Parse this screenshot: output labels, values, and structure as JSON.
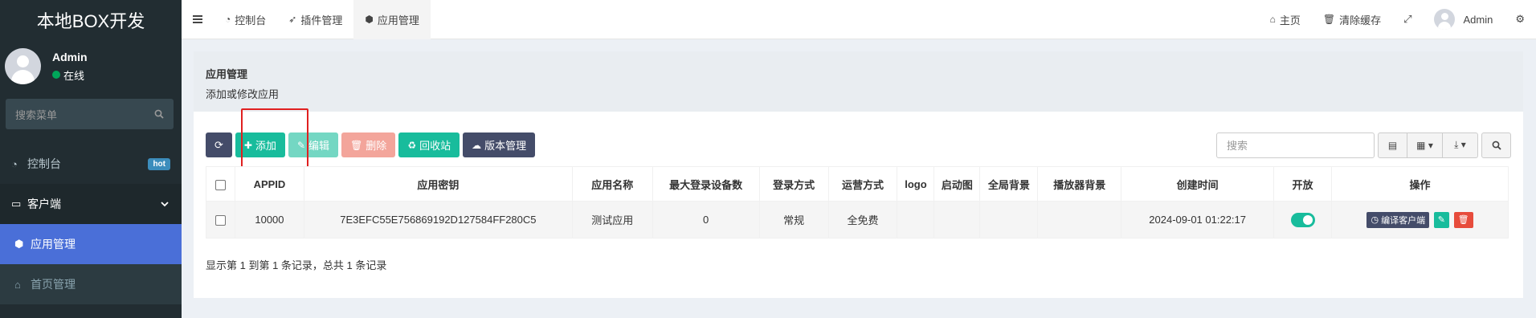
{
  "app": {
    "title": "本地BOX开发"
  },
  "user": {
    "name": "Admin",
    "status": "在线"
  },
  "sidebar": {
    "search_placeholder": "搜索菜单",
    "items": [
      {
        "label": "控制台",
        "icon": "dashboard-icon",
        "badge": "hot"
      },
      {
        "label": "客户端",
        "icon": "tv-icon"
      },
      {
        "label": "应用管理",
        "icon": "android-icon"
      },
      {
        "label": "首页管理",
        "icon": "home-icon"
      }
    ]
  },
  "topbar": {
    "tabs": [
      {
        "label": "控制台",
        "icon": "dashboard-icon"
      },
      {
        "label": "插件管理",
        "icon": "rocket-icon"
      },
      {
        "label": "应用管理",
        "icon": "android-icon"
      }
    ],
    "home_label": "主页",
    "clear_cache_label": "清除缓存",
    "user_name": "Admin"
  },
  "page": {
    "title": "应用管理",
    "subtitle": "添加或修改应用"
  },
  "toolbar": {
    "add": "添加",
    "edit": "编辑",
    "delete": "删除",
    "recycle": "回收站",
    "version": "版本管理",
    "search_placeholder": "搜索"
  },
  "table": {
    "columns": [
      "APPID",
      "应用密钥",
      "应用名称",
      "最大登录设备数",
      "登录方式",
      "运营方式",
      "logo",
      "启动图",
      "全局背景",
      "播放器背景",
      "创建时间",
      "开放",
      "操作"
    ],
    "rows": [
      {
        "appid": "10000",
        "key": "7E3EFC55E756869192D127584FF280C5",
        "name": "测试应用",
        "max_devices": "0",
        "login": "常规",
        "operation": "全免费",
        "logo": "",
        "splash": "",
        "global_bg": "",
        "player_bg": "",
        "created": "2024-09-01 01:22:17",
        "open": true,
        "compile_label": "编译客户端"
      }
    ]
  },
  "summary": "显示第 1 到第 1 条记录，总共 1 条记录",
  "colors": {
    "accent": "#18bc9c",
    "sidebar_bg": "#222d32",
    "active": "#4a6fd8",
    "highlight": "#e02020"
  }
}
